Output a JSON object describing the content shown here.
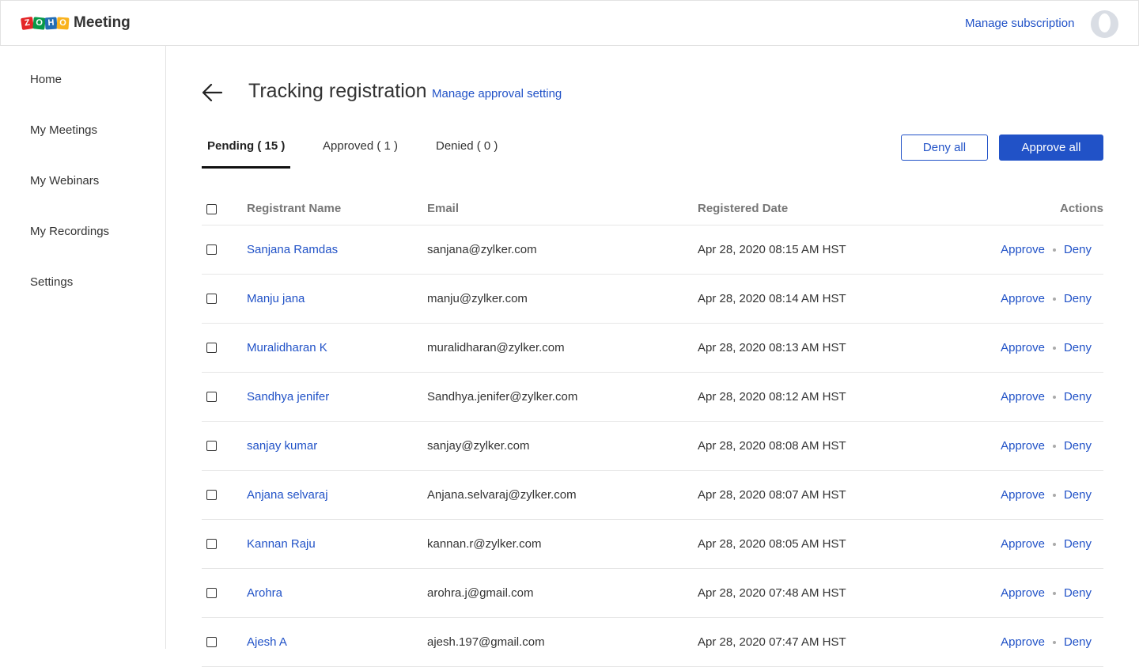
{
  "header": {
    "logo_brand": "ZOHO",
    "logo_letters": [
      "Z",
      "O",
      "H",
      "O"
    ],
    "app_name": "Meeting",
    "manage_subscription": "Manage subscription",
    "avatar_icon": "user-avatar-icon"
  },
  "sidebar": {
    "items": [
      {
        "label": "Home"
      },
      {
        "label": "My Meetings"
      },
      {
        "label": "My Webinars"
      },
      {
        "label": "My Recordings"
      },
      {
        "label": "Settings"
      }
    ]
  },
  "page": {
    "back_icon": "arrow-left-icon",
    "title": "Tracking registration",
    "approval_link": "Manage approval setting",
    "tabs": [
      {
        "label": "Pending ( 15 )",
        "active": true
      },
      {
        "label": "Approved ( 1 )",
        "active": false
      },
      {
        "label": "Denied ( 0 )",
        "active": false
      }
    ],
    "deny_all": "Deny all",
    "approve_all": "Approve all"
  },
  "table": {
    "columns": {
      "name": "Registrant Name",
      "email": "Email",
      "date": "Registered Date",
      "actions": "Actions"
    },
    "approve_label": "Approve",
    "deny_label": "Deny",
    "rows": [
      {
        "name": "Sanjana Ramdas",
        "email": "sanjana@zylker.com",
        "date": "Apr 28, 2020 08:15 AM HST"
      },
      {
        "name": "Manju jana",
        "email": "manju@zylker.com",
        "date": "Apr 28, 2020 08:14 AM HST"
      },
      {
        "name": "Muralidharan K",
        "email": "muralidharan@zylker.com",
        "date": "Apr 28, 2020 08:13 AM HST"
      },
      {
        "name": "Sandhya jenifer",
        "email": "Sandhya.jenifer@zylker.com",
        "date": "Apr 28, 2020 08:12 AM HST"
      },
      {
        "name": "sanjay kumar",
        "email": "sanjay@zylker.com",
        "date": "Apr 28, 2020 08:08 AM HST"
      },
      {
        "name": "Anjana selvaraj",
        "email": "Anjana.selvaraj@zylker.com",
        "date": "Apr 28, 2020 08:07 AM HST"
      },
      {
        "name": "Kannan Raju",
        "email": "kannan.r@zylker.com",
        "date": "Apr 28, 2020 08:05 AM HST"
      },
      {
        "name": "Arohra",
        "email": "arohra.j@gmail.com",
        "date": "Apr 28, 2020 07:48 AM HST"
      },
      {
        "name": "Ajesh A",
        "email": "ajesh.197@gmail.com",
        "date": "Apr 28, 2020 07:47 AM HST"
      }
    ]
  },
  "colors": {
    "accent": "#2152c7",
    "text": "#333333",
    "header_text": "#777777",
    "border": "#e6e6e6"
  }
}
